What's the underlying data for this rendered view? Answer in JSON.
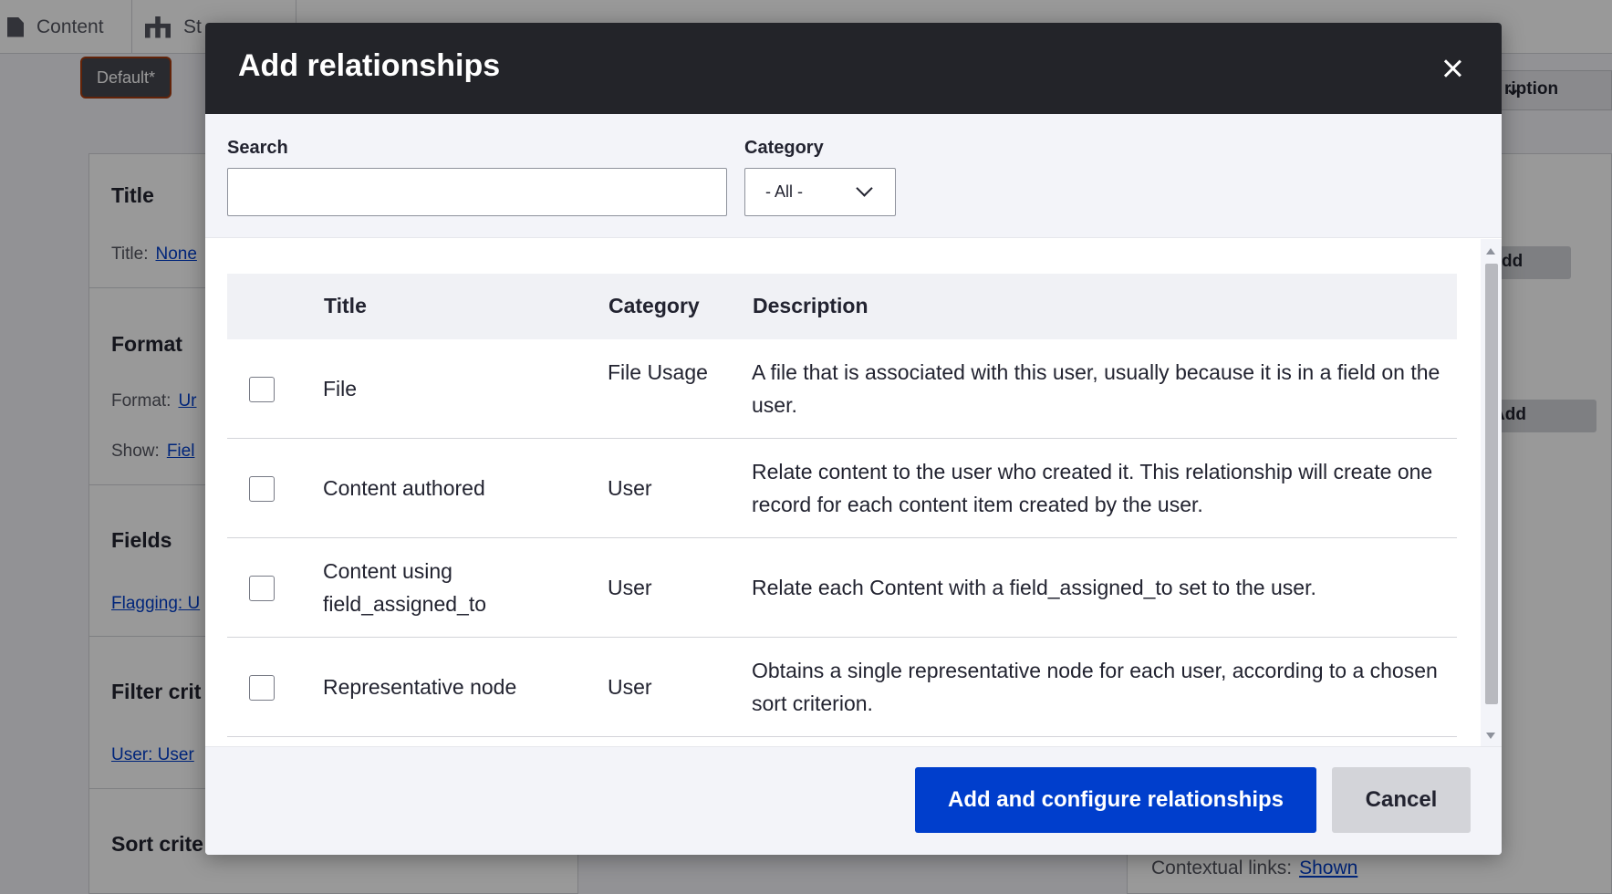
{
  "toolbar": {
    "items": [
      {
        "label": "Content"
      },
      {
        "label": "St"
      }
    ]
  },
  "background": {
    "display_tab": "Default*",
    "sections": {
      "title": {
        "heading": "Title",
        "row_label": "Title:",
        "row_link": "None"
      },
      "format": {
        "heading": "Format",
        "format_label": "Format:",
        "format_link": "Ur",
        "show_label": "Show:",
        "show_link": "Fiel"
      },
      "fields": {
        "heading": "Fields",
        "link": "Flagging: U"
      },
      "filter": {
        "heading": "Filter crit",
        "link": "User: User"
      },
      "sort": {
        "heading": "Sort crite"
      }
    },
    "right": {
      "strip_label": "ription",
      "add_label_1": "dd",
      "add_label_2": "Add",
      "contextual_label": "Contextual links:",
      "contextual_value": "Shown"
    }
  },
  "modal": {
    "title": "Add relationships",
    "search": {
      "label": "Search",
      "value": "",
      "placeholder": ""
    },
    "category": {
      "label": "Category",
      "selected": "- All -"
    },
    "table": {
      "headers": {
        "title": "Title",
        "category": "Category",
        "description": "Description"
      },
      "rows": [
        {
          "title": "File",
          "category": "File Usage",
          "description": "A file that is associated with this user, usually because it is in a field on the user."
        },
        {
          "title": "Content authored",
          "category": "User",
          "description": "Relate content to the user who created it. This relationship will create one record for each content item created by the user."
        },
        {
          "title": "Content using field_assigned_to",
          "category": "User",
          "description": "Relate each Content with a field_assigned_to set to the user."
        },
        {
          "title": "Representative node",
          "category": "User",
          "description": "Obtains a single representative node for each user, according to a chosen sort criterion."
        }
      ]
    },
    "buttons": {
      "primary": "Add and configure relationships",
      "secondary": "Cancel"
    }
  },
  "colors": {
    "primary_button": "#003ecc",
    "modal_header": "#232429",
    "link": "#003ecc"
  }
}
